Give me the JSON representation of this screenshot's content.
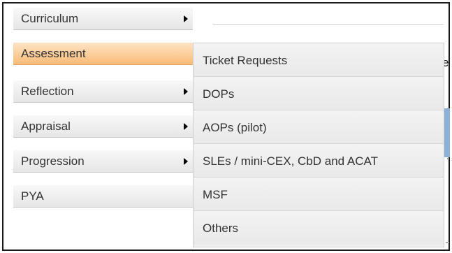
{
  "menu": {
    "items": [
      {
        "label": "Curriculum",
        "has_submenu": true
      },
      {
        "label": "Assessment",
        "has_submenu": false,
        "active": true
      },
      {
        "label": "Reflection",
        "has_submenu": true
      },
      {
        "label": "Appraisal",
        "has_submenu": true
      },
      {
        "label": "Progression",
        "has_submenu": true
      },
      {
        "label": "PYA",
        "has_submenu": false
      }
    ]
  },
  "submenu": {
    "items": [
      {
        "label": "Ticket Requests"
      },
      {
        "label": "DOPs"
      },
      {
        "label": "AOPs (pilot)"
      },
      {
        "label": "SLEs / mini-CEX, CbD and ACAT"
      },
      {
        "label": "MSF"
      },
      {
        "label": "Others"
      }
    ]
  },
  "background": {
    "partial_text": "e"
  },
  "colors": {
    "active_item": "#f9bb78",
    "menu_bg": "#eeeeee",
    "arrow": "#000000"
  }
}
